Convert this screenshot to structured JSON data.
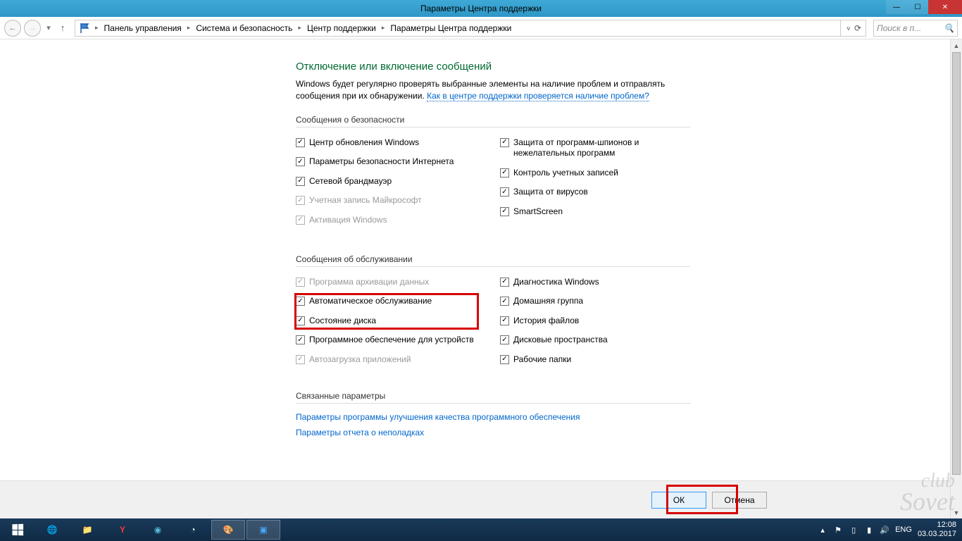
{
  "window": {
    "title": "Параметры Центра поддержки"
  },
  "breadcrumb": {
    "items": [
      "Панель управления",
      "Система и безопасность",
      "Центр поддержки",
      "Параметры Центра поддержки"
    ]
  },
  "search": {
    "placeholder": "Поиск в п..."
  },
  "page": {
    "heading": "Отключение или включение сообщений",
    "intro_pre": "Windows будет регулярно проверять выбранные элементы на наличие проблем и отправлять сообщения при их обнаружении. ",
    "intro_link": "Как в центре поддержки проверяется наличие проблем?"
  },
  "sections": {
    "security": {
      "title": "Сообщения о безопасности",
      "left": [
        {
          "label": "Центр обновления Windows",
          "checked": true,
          "disabled": false
        },
        {
          "label": "Параметры безопасности Интернета",
          "checked": true,
          "disabled": false
        },
        {
          "label": "Сетевой брандмауэр",
          "checked": true,
          "disabled": false
        },
        {
          "label": "Учетная запись Майкрософт",
          "checked": true,
          "disabled": true
        },
        {
          "label": "Активация Windows",
          "checked": true,
          "disabled": true
        }
      ],
      "right": [
        {
          "label": "Защита от программ-шпионов и нежелательных программ",
          "checked": true,
          "disabled": false
        },
        {
          "label": "Контроль учетных записей",
          "checked": true,
          "disabled": false
        },
        {
          "label": "Защита от вирусов",
          "checked": true,
          "disabled": false
        },
        {
          "label": "SmartScreen",
          "checked": true,
          "disabled": false
        }
      ]
    },
    "maintenance": {
      "title": "Сообщения об обслуживании",
      "left": [
        {
          "label": "Программа архивации данных",
          "checked": true,
          "disabled": true
        },
        {
          "label": "Автоматическое обслуживание",
          "checked": true,
          "disabled": false
        },
        {
          "label": "Состояние диска",
          "checked": true,
          "disabled": false
        },
        {
          "label": "Программное обеспечение для устройств",
          "checked": true,
          "disabled": false
        },
        {
          "label": "Автозагрузка приложений",
          "checked": true,
          "disabled": true
        }
      ],
      "right": [
        {
          "label": "Диагностика Windows",
          "checked": true,
          "disabled": false
        },
        {
          "label": "Домашняя группа",
          "checked": true,
          "disabled": false
        },
        {
          "label": "История файлов",
          "checked": true,
          "disabled": false
        },
        {
          "label": "Дисковые пространства",
          "checked": true,
          "disabled": false
        },
        {
          "label": "Рабочие папки",
          "checked": true,
          "disabled": false
        }
      ]
    },
    "related": {
      "title": "Связанные параметры",
      "links": [
        "Параметры программы улучшения качества программного обеспечения",
        "Параметры отчета о неполадках"
      ]
    }
  },
  "footer": {
    "ok": "ОК",
    "cancel": "Отмена"
  },
  "tray": {
    "lang": "ENG",
    "time": "12:08",
    "date": "03.03.2017"
  },
  "watermark": "club\nSovet"
}
